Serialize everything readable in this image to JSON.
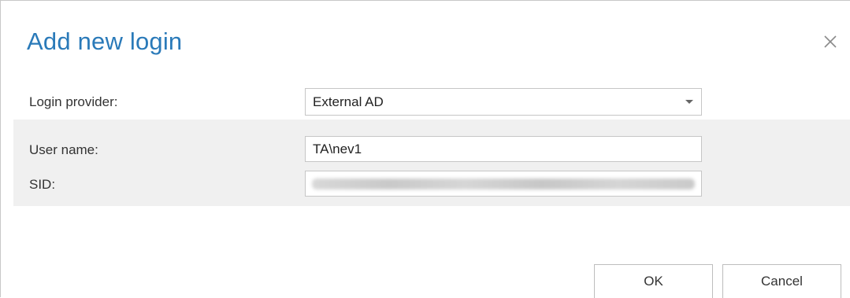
{
  "dialog": {
    "title": "Add new login",
    "close_icon": "close-icon"
  },
  "form": {
    "login_provider_label": "Login provider:",
    "login_provider_value": "External AD",
    "user_name_label": "User name:",
    "user_name_value": "TA\\nev1",
    "sid_label": "SID:",
    "sid_value": ""
  },
  "buttons": {
    "ok_label": "OK",
    "cancel_label": "Cancel"
  },
  "colors": {
    "title": "#2a7ab9",
    "band": "#f0f0f0",
    "border": "#c6c6c6"
  }
}
